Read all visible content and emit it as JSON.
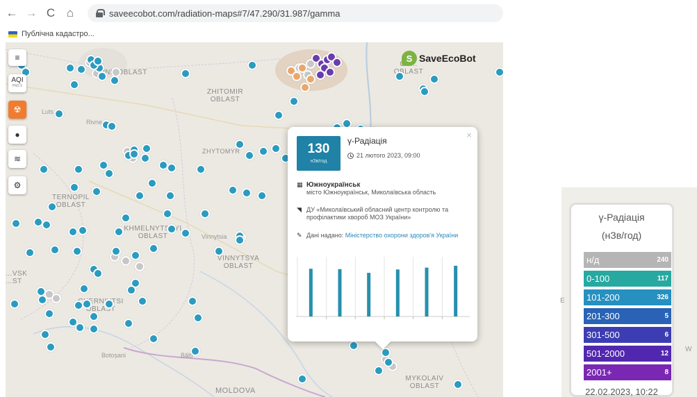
{
  "browser": {
    "back_icon": "←",
    "forward_icon": "→",
    "reload_icon": "C",
    "home_icon": "⌂",
    "url": "saveecobot.com/radiation-maps#7/47.290/31.987/gamma",
    "bookmark_label": "Публічна кадастро..."
  },
  "map": {
    "logo_text": "SaveEcoBot",
    "aqi_label": "AQI",
    "aqi_sub": "PM2.5",
    "menu_icon": "≡",
    "radiation_icon": "☢",
    "drop_icon": "●",
    "layers_icon": "≋",
    "settings_icon": "⚙",
    "places": {
      "rivne": "RIVNE OBLAST",
      "zhitomir": "ZHITOMIR OBLAST",
      "zhytomyr_city": "ZHYTOMYR",
      "ternopil": "TERNOPIL OBLAST",
      "khmelnytskyi": "KHMELNYTSKYI OBLAST",
      "vinnytsya": "VINNYTSYA OBLAST",
      "vinnytsia_city": "Vinnytsia",
      "chernivtsi": "CHERNIVTSI OBLAST",
      "mykolaiv": "MYKOLAIV OBLAST",
      "moldova": "MOLDOVA",
      "chernihiv": "CH... OBLAST",
      "ivano": "...VSK ...ST",
      "lutsk": "Luts",
      "rivne_city": "Rivne",
      "botosani": "Botoșani",
      "balti": "Bălți"
    }
  },
  "popup": {
    "value": "130",
    "unit": "нЗв/год",
    "title": "γ-Радіація",
    "date": "21 лютого 2023, 09:00",
    "city": "Южноукраїнськ",
    "city_detail": "місто Южноукраїнськ, Миколаївська область",
    "org": "ДУ «Миколаївський обласний центр контролю та профілактики хвороб МОЗ України»",
    "source_prefix": "Дані надано:",
    "source_link": "Міністерство охорони здоров'я України",
    "close_icon": "×"
  },
  "popup_chart": {
    "type": "bar",
    "values": [
      128,
      127,
      117,
      126,
      131,
      136
    ],
    "ylim": [
      0,
      160
    ],
    "color": "#2690ad",
    "tick_labels": [
      "",
      "",
      "",
      "",
      ""
    ]
  },
  "legend": {
    "title": "γ-Радіація",
    "unit": "(нЗв/год)",
    "rows": [
      {
        "range": "н/д",
        "count": "240",
        "color": "#b5b5b5"
      },
      {
        "range": "0-100",
        "count": "117",
        "color": "#27a9a1"
      },
      {
        "range": "101-200",
        "count": "326",
        "color": "#2690c1"
      },
      {
        "range": "201-300",
        "count": "5",
        "color": "#2a63b6"
      },
      {
        "range": "301-500",
        "count": "6",
        "color": "#3d3db3"
      },
      {
        "range": "501-2000",
        "count": "12",
        "color": "#5227b0"
      },
      {
        "range": "2001+",
        "count": "8",
        "color": "#7a28b4"
      }
    ],
    "timestamp": "22.02.2023, 10:22"
  }
}
